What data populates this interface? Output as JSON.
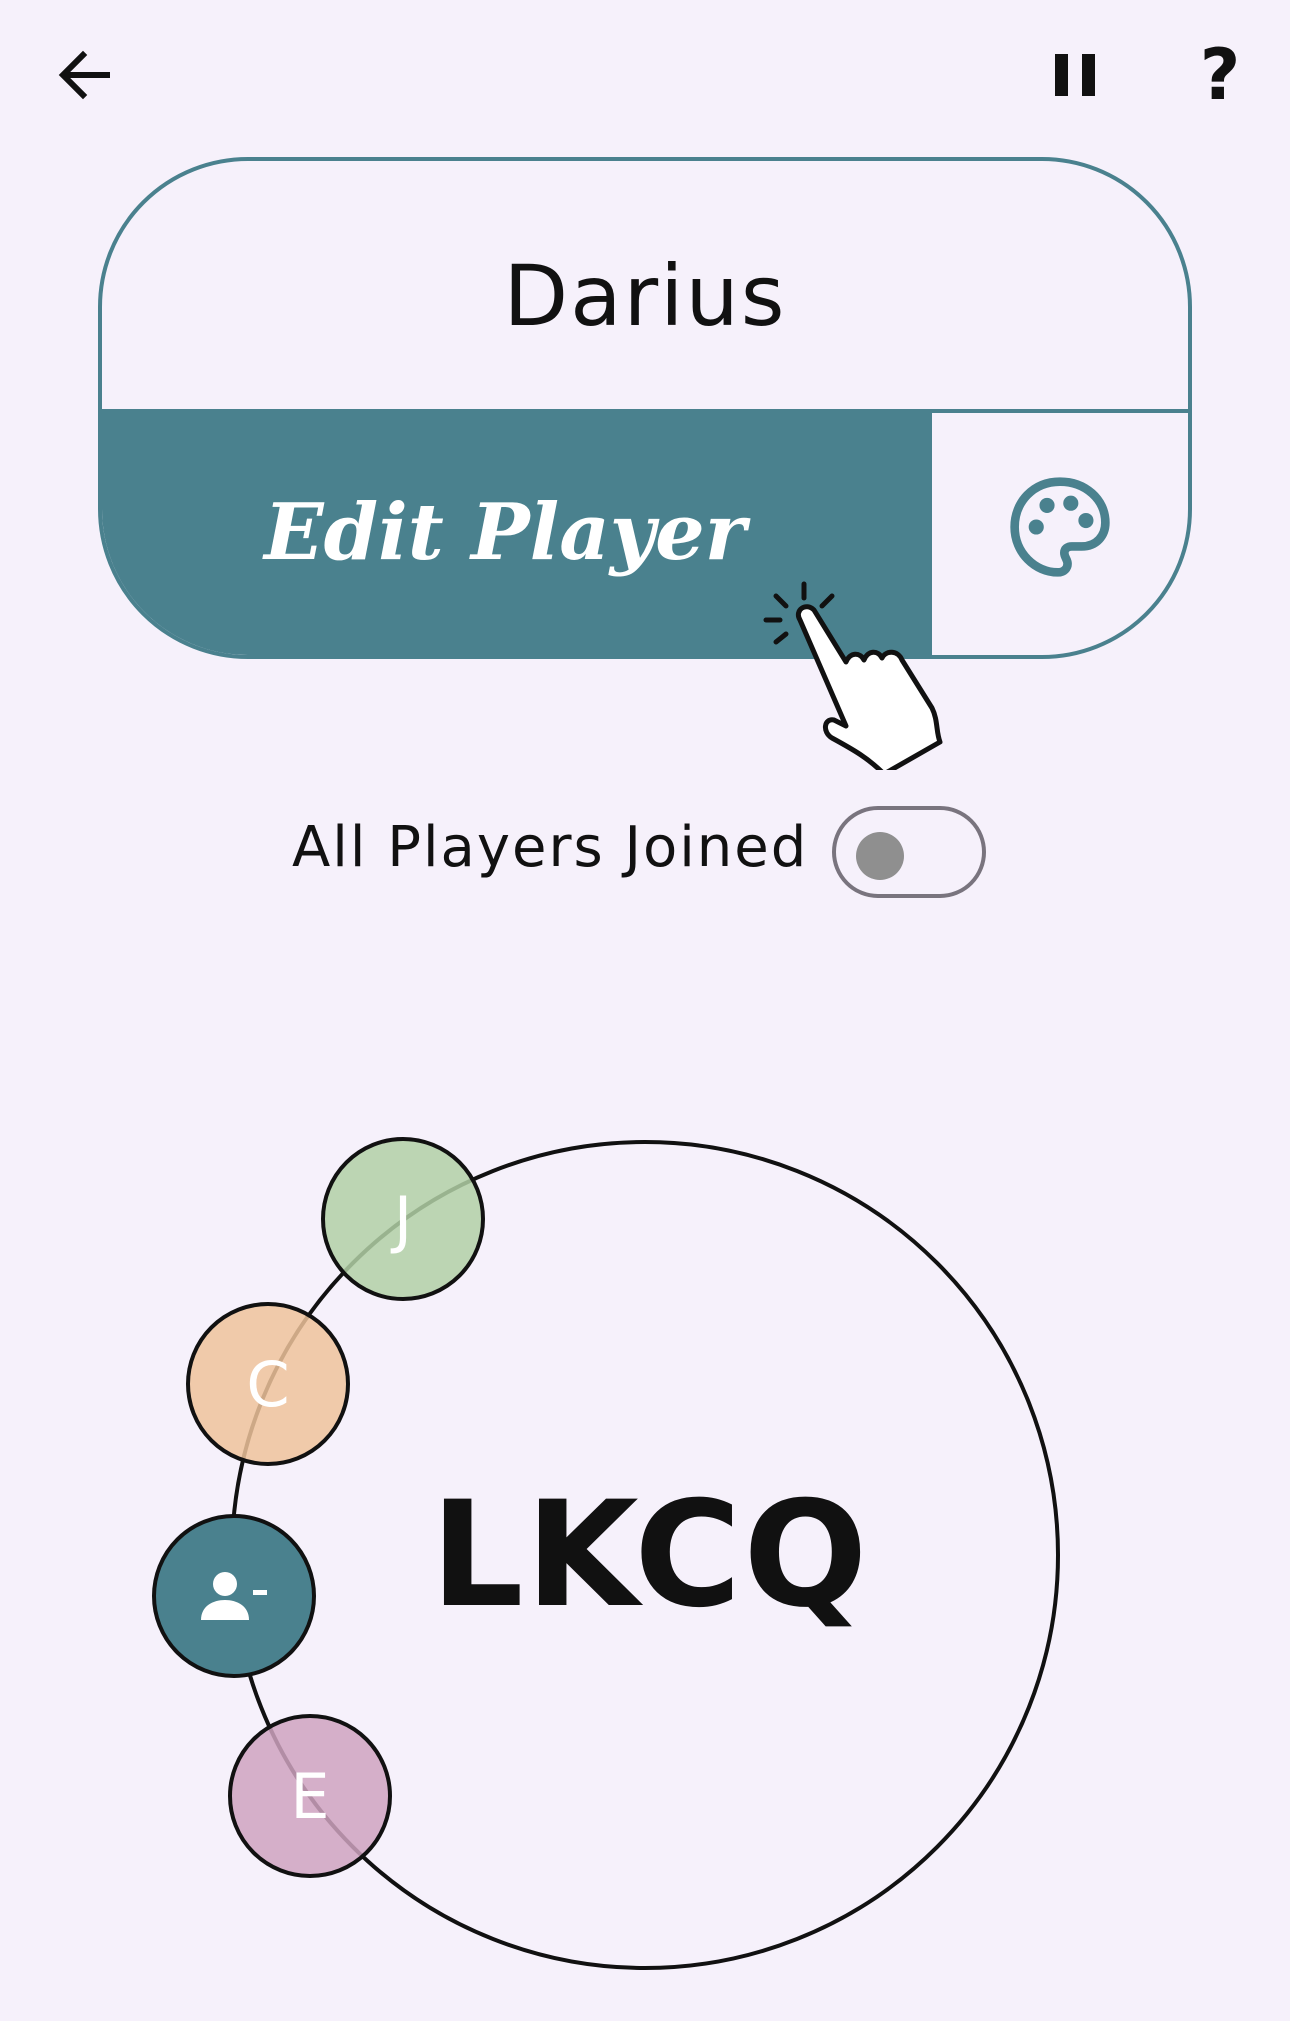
{
  "topbar": {
    "back_icon": "arrow-left-icon",
    "pause_icon": "pause-icon",
    "help_label": "?"
  },
  "player_card": {
    "name": "Darius",
    "edit_label": "Edit Player",
    "palette_icon": "palette-icon",
    "accent_color": "#4a818e"
  },
  "join_toggle": {
    "label": "All Players Joined",
    "on": false
  },
  "table": {
    "code": "LKCQ",
    "seats": [
      {
        "initial": "J",
        "color": "#b1d0a6"
      },
      {
        "initial": "C",
        "color": "#efc39b"
      },
      {
        "initial": "",
        "icon": "remove-person-icon",
        "color": "#4a818e"
      },
      {
        "initial": "E",
        "color": "#cfa3bf"
      }
    ]
  },
  "hint": {
    "icon": "tap-hand-icon"
  }
}
